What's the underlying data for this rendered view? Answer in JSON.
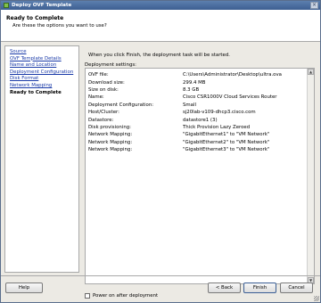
{
  "window": {
    "title": "Deploy OVF Template",
    "close_glyph": "×"
  },
  "header": {
    "title": "Ready to Complete",
    "subtitle": "Are these the options you want to use?"
  },
  "sidebar": {
    "steps": [
      {
        "label": "Source"
      },
      {
        "label": "OVF Template Details"
      },
      {
        "label": "Name and Location"
      },
      {
        "label": "Deployment Configuration"
      },
      {
        "label": "Disk Format"
      },
      {
        "label": "Network Mapping"
      },
      {
        "label": "Ready to Complete"
      }
    ]
  },
  "main": {
    "intro": "When you click Finish, the deployment task will be started.",
    "settings_label": "Deployment settings:",
    "settings": [
      {
        "key": "OVF file:",
        "value": "C:\\Users\\Administrator\\Desktop\\ultra.ova"
      },
      {
        "key": "Download size:",
        "value": "299.4 MB"
      },
      {
        "key": "Size on disk:",
        "value": "8.3 GB"
      },
      {
        "key": "Name:",
        "value": "Cisco CSR1000V Cloud Services Router"
      },
      {
        "key": "Deployment Configuration:",
        "value": "Small"
      },
      {
        "key": "Host/Cluster:",
        "value": "sj20lab-v109-dhcp3.cisco.com"
      },
      {
        "key": "Datastore:",
        "value": "datastore1 (3)"
      },
      {
        "key": "Disk provisioning:",
        "value": "Thick Provision Lazy Zeroed"
      },
      {
        "key": "Network Mapping:",
        "value": "\"GigabitEthernet1\" to \"VM Network\""
      },
      {
        "key": "Network Mapping:",
        "value": "\"GigabitEthernet2\" to \"VM Network\""
      },
      {
        "key": "Network Mapping:",
        "value": "\"GigabitEthernet3\" to \"VM Network\""
      }
    ],
    "power_on_label": "Power on after deployment",
    "power_on_checked": false
  },
  "footer": {
    "help_label": "Help",
    "back_label": "< Back",
    "finish_label": "Finish",
    "cancel_label": "Cancel"
  }
}
